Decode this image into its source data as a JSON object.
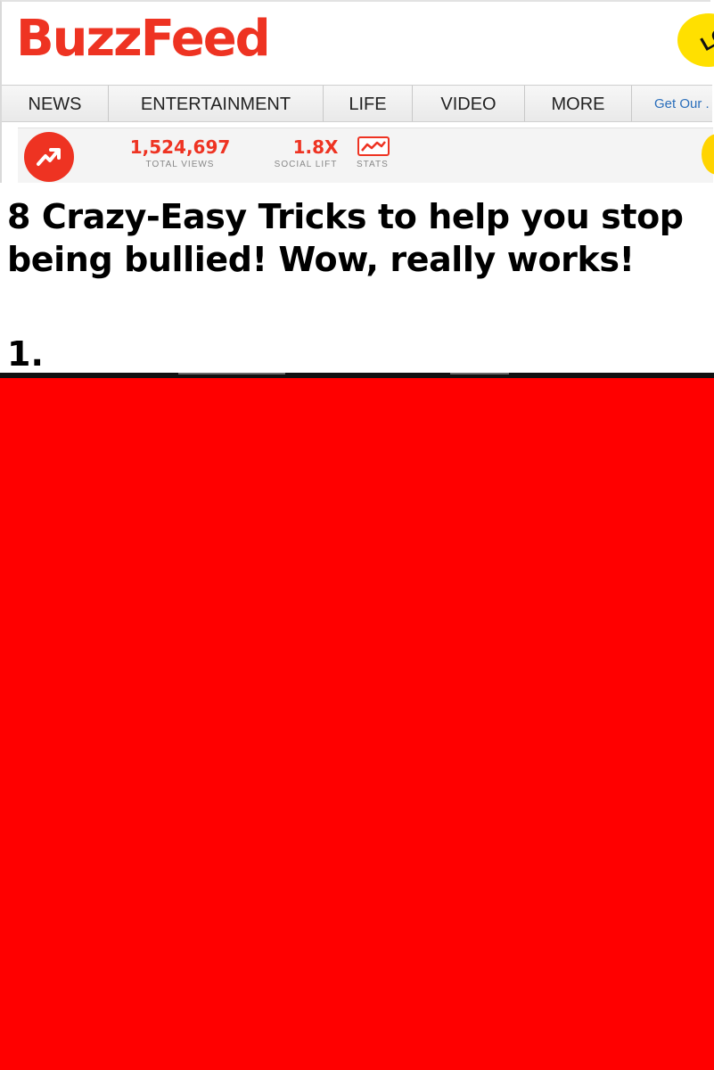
{
  "header": {
    "logo_text": "BuzzFeed",
    "badge_text": "LO"
  },
  "nav": {
    "items": [
      {
        "label": "NEWS"
      },
      {
        "label": "ENTERTAINMENT"
      },
      {
        "label": "LIFE"
      },
      {
        "label": "VIDEO"
      },
      {
        "label": "MORE"
      }
    ],
    "cta_label": "Get Our ."
  },
  "stats": {
    "total_views_value": "1,524,697",
    "total_views_label": "TOTAL VIEWS",
    "social_lift_value": "1.8X",
    "social_lift_label": "SOCIAL LIFT",
    "stats_label": "STATS",
    "trend_icon": "trending-arrow-icon",
    "stats_icon": "line-chart-icon"
  },
  "article": {
    "headline": "8 Crazy-Easy Tricks to help you stop being bullied! Wow, really works!",
    "item_number": "1."
  },
  "colors": {
    "brand": "#ee3322",
    "block": "#ff0000",
    "link": "#2a6ebb",
    "badge": "#ffe000"
  }
}
